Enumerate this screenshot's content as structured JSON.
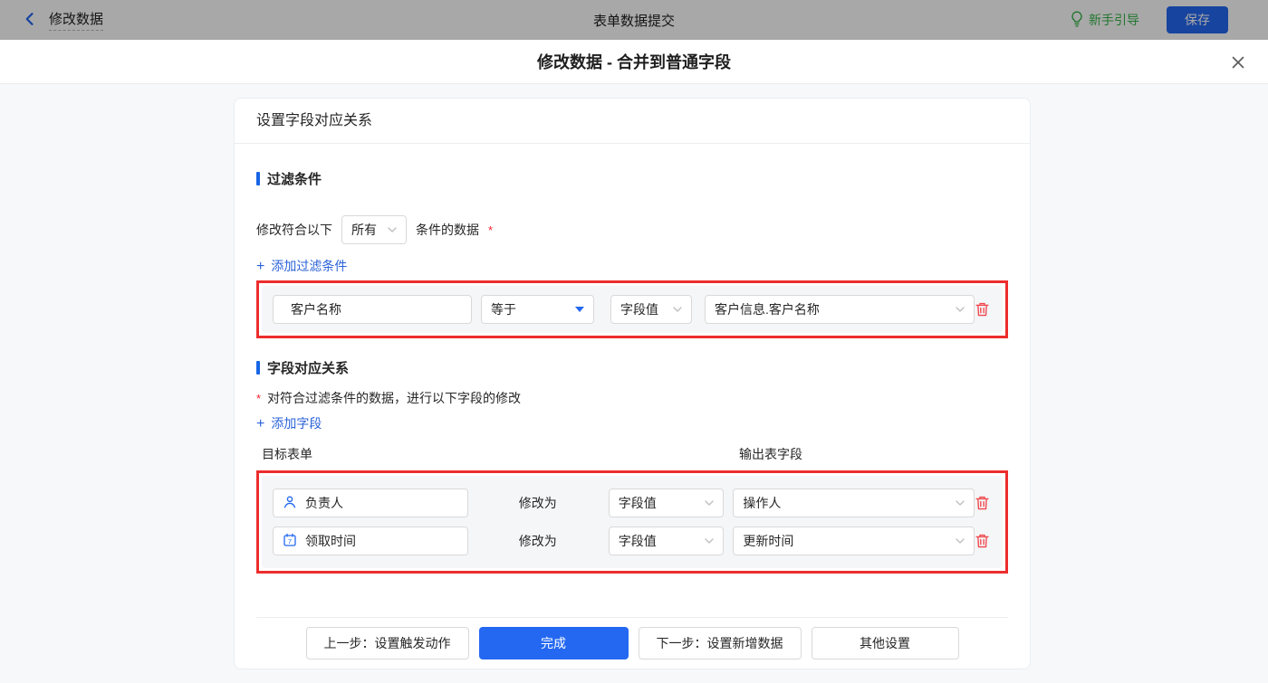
{
  "colors": {
    "accent_blue": "#2468f2",
    "section_bar_blue": "#1765e5",
    "link_blue": "#2b63d9",
    "guide_green": "#36b34a",
    "annotation_red": "#ed2d2d",
    "danger_red": "#f0484d",
    "asterisk_red": "#f5222d"
  },
  "topbar": {
    "back_label": "修改数据",
    "title": "表单数据提交",
    "guide_label": "新手引导",
    "save_label": "保存"
  },
  "modal": {
    "title": "修改数据 - 合并到普通字段"
  },
  "card": {
    "title": "设置字段对应关系",
    "filter": {
      "heading": "过滤条件",
      "prefix": "修改符合以下",
      "scope_value": "所有",
      "suffix": "条件的数据",
      "required_mark": "*",
      "add_label": "添加过滤条件",
      "rows": [
        {
          "field": "客户名称",
          "operator": "等于",
          "value_type": "字段值",
          "value": "客户信息.客户名称"
        }
      ]
    },
    "mapping": {
      "heading": "字段对应关系",
      "required_mark": "*",
      "description": "对符合过滤条件的数据，进行以下字段的修改",
      "add_label": "添加字段",
      "col_left": "目标表单",
      "col_right": "输出表字段",
      "modify_label": "修改为",
      "rows": [
        {
          "field": "负责人",
          "value_type": "字段值",
          "value": "操作人"
        },
        {
          "field": "领取时间",
          "value_type": "字段值",
          "value": "更新时间"
        }
      ]
    },
    "footer": {
      "prev_label": "上一步：设置触发动作",
      "done_label": "完成",
      "next_label": "下一步：设置新增数据",
      "other_label": "其他设置"
    }
  }
}
